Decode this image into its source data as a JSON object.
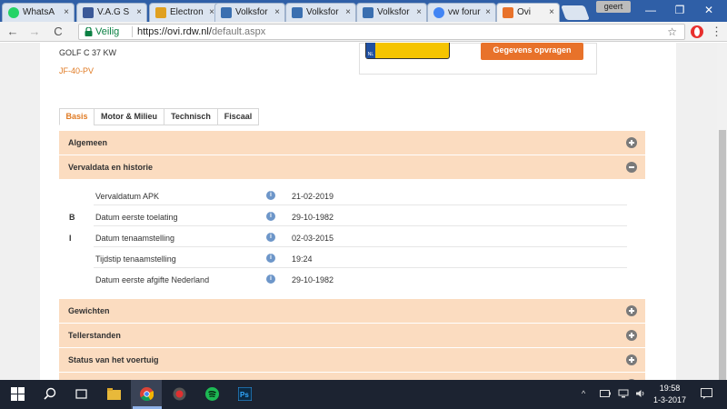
{
  "browser": {
    "tabs": [
      {
        "label": "WhatsA",
        "fav_color": "#25d366",
        "close": "×"
      },
      {
        "label": "V.A.G S",
        "fav_color": "#3b5998",
        "close": "×"
      },
      {
        "label": "Electron",
        "fav_color": "#e0a020",
        "close": "×"
      },
      {
        "label": "Volksfor",
        "fav_color": "#3a6fb0",
        "close": "×"
      },
      {
        "label": "Volksfor",
        "fav_color": "#3a6fb0",
        "close": "×"
      },
      {
        "label": "Volksfor",
        "fav_color": "#3a6fb0",
        "close": "×"
      },
      {
        "label": "vw forur",
        "fav_color": "#4285f4",
        "close": "×"
      },
      {
        "label": "Ovi",
        "fav_color": "#e8722a",
        "close": "×"
      }
    ],
    "profile": "geert",
    "window_controls": {
      "minimize": "—",
      "maximize": "❐",
      "close": "✕"
    },
    "nav": {
      "back": "←",
      "forward": "→",
      "reload": "C"
    },
    "secure_label": "Veilig",
    "url_host": "https://ovi.rdw.nl/",
    "url_path": "default.aspx",
    "bookmark_star": "☆",
    "menu_glyph": "⋮"
  },
  "vehicle": {
    "model": "GOLF C 37 KW",
    "plate": "JF-40-PV",
    "plate_country": "NL"
  },
  "request_button": "Gegevens opvragen",
  "tabs": [
    {
      "label": "Basis",
      "active": true
    },
    {
      "label": "Motor & Milieu",
      "active": false
    },
    {
      "label": "Technisch",
      "active": false
    },
    {
      "label": "Fiscaal",
      "active": false
    }
  ],
  "sections": {
    "algemeen": "Algemeen",
    "vervaldata": "Vervaldata en historie",
    "gewichten": "Gewichten",
    "tellerstanden": "Tellerstanden",
    "status": "Status van het voertuig"
  },
  "details": [
    {
      "code": "",
      "label": "Vervaldatum APK",
      "info": "i",
      "value": "21-02-2019"
    },
    {
      "code": "B",
      "label": "Datum eerste toelating",
      "info": "i",
      "value": "29-10-1982"
    },
    {
      "code": "I",
      "label": "Datum tenaamstelling",
      "info": "i",
      "value": "02-03-2015"
    },
    {
      "code": "",
      "label": "Tijdstip tenaamstelling",
      "info": "i",
      "value": "19:24"
    },
    {
      "code": "",
      "label": "Datum eerste afgifte Nederland",
      "info": "i",
      "value": "29-10-1982"
    }
  ],
  "taskbar": {
    "time": "19:58",
    "date": "1-3-2017",
    "tray_up": "^"
  }
}
